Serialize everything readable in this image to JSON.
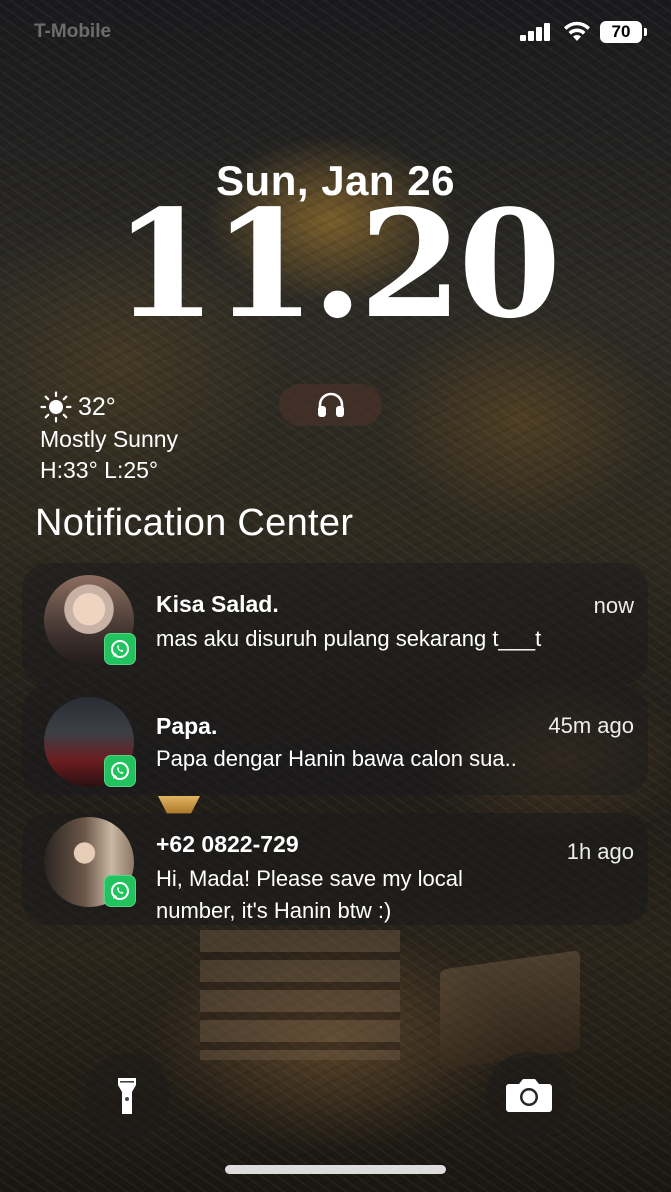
{
  "status_bar": {
    "carrier": "T-Mobile",
    "battery": "70",
    "battery_level_percent": 70,
    "signal_icon": "cellular-signal-icon",
    "wifi_icon": "wifi-icon"
  },
  "lock": {
    "date": "Sun, Jan 26",
    "time": "11.20"
  },
  "weather": {
    "icon": "sun-icon",
    "temp": "32°",
    "condition": "Mostly Sunny",
    "high_low": "H:33° L:25°"
  },
  "audio_widget": {
    "icon": "headphones-icon"
  },
  "notification_center": {
    "title": "Notification Center",
    "notifications": [
      {
        "app_icon": "whatsapp-icon",
        "sender": "Kisa Salad.",
        "time": "now",
        "message": "mas aku disuruh pulang sekarang t___t"
      },
      {
        "app_icon": "whatsapp-icon",
        "sender": "Papa.",
        "time": "45m ago",
        "message": "Papa dengar Hanin bawa calon sua.."
      },
      {
        "app_icon": "whatsapp-icon",
        "sender": "+62 0822-729",
        "time": "1h ago",
        "message": "Hi, Mada! Please save my local number, it's Hanin btw :)"
      }
    ]
  },
  "quick_actions": {
    "flashlight_icon": "flashlight-icon",
    "camera_icon": "camera-icon"
  },
  "colors": {
    "whatsapp_green": "#22c35e",
    "text": "#ffffff"
  }
}
